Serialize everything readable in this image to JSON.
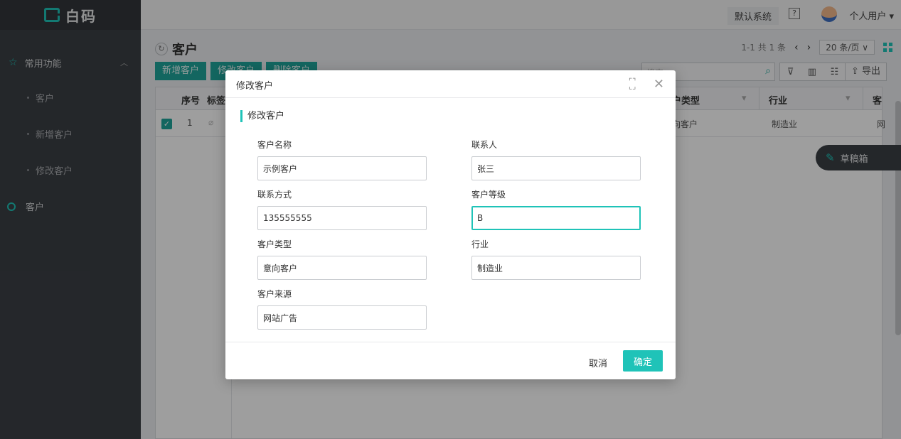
{
  "app": {
    "logo_text": "白码"
  },
  "sidebar": {
    "group_label": "常用功能",
    "sub_items": [
      {
        "label": "客户"
      },
      {
        "label": "新增客户"
      },
      {
        "label": "修改客户"
      }
    ],
    "main_item": "客户"
  },
  "topbar": {
    "system": "默认系统",
    "user": "个人用户"
  },
  "page": {
    "title": "客户",
    "pager_text": "1-1 共 1 条",
    "page_size": "20 条/页",
    "buttons": [
      "新增客户",
      "修改客户",
      "删除客户"
    ],
    "search_placeholder": "搜索",
    "export_label": "导出"
  },
  "table": {
    "headers": {
      "index": "序号",
      "tag": "标签",
      "type": "户类型",
      "industry": "行业",
      "source": "客"
    },
    "row": {
      "index": "1",
      "type": "向客户",
      "industry": "制造业",
      "source": "网"
    }
  },
  "draft": {
    "label": "草稿箱"
  },
  "modal": {
    "title": "修改客户",
    "section": "修改客户",
    "fields": {
      "name": {
        "label": "客户名称",
        "value": "示例客户"
      },
      "contact": {
        "label": "联系人",
        "value": "张三"
      },
      "phone": {
        "label": "联系方式",
        "value": "135555555"
      },
      "level": {
        "label": "客户等级",
        "value": "B"
      },
      "type": {
        "label": "客户类型",
        "value": "意向客户"
      },
      "industry": {
        "label": "行业",
        "value": "制造业"
      },
      "source": {
        "label": "客户来源",
        "value": "网站广告"
      }
    },
    "cancel": "取消",
    "ok": "确定"
  },
  "colors": {
    "accent": "#1fc3b8",
    "sidebar_bg": "#3b3f45"
  }
}
